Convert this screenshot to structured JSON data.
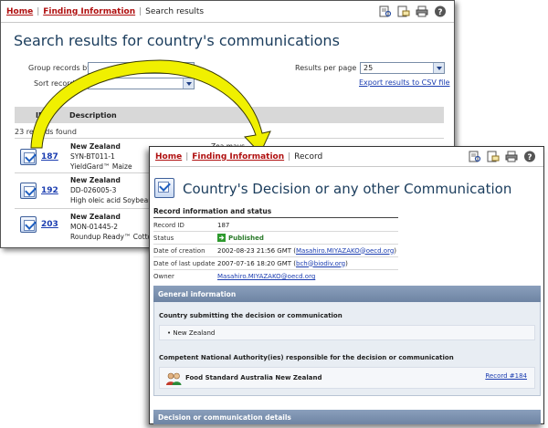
{
  "back_window": {
    "breadcrumb": {
      "home": "Home",
      "finding": "Finding Information",
      "current": "Search results"
    },
    "title": "Search results for country's communications",
    "group_by_label": "Group records by",
    "sort_by_label": "Sort records by",
    "results_per_page_label": "Results per page",
    "results_per_page_value": "25",
    "export_link": "Export results to CSV file",
    "table_headers": {
      "id": "ID",
      "description": "Description"
    },
    "records_found": "23 records found",
    "rows": [
      {
        "id": "187",
        "country": "New Zealand",
        "code": "SYN-BT011-1",
        "product": "YieldGard™ Maize",
        "extra": "Zea mays"
      },
      {
        "id": "192",
        "country": "New Zealand",
        "code": "DD-026005-3",
        "product": "High oleic acid Soybean",
        "extra": ""
      },
      {
        "id": "203",
        "country": "New Zealand",
        "code": "MON-01445-2",
        "product": "Roundup Ready™ Cotton",
        "extra": ""
      }
    ]
  },
  "front_window": {
    "breadcrumb": {
      "home": "Home",
      "finding": "Finding Information",
      "current": "Record"
    },
    "title": "Country's Decision or any other Communication",
    "section_title": "Record information and status",
    "fields": [
      {
        "key": "Record ID",
        "value": "187"
      },
      {
        "key": "Status",
        "value": "Published"
      },
      {
        "key": "Date of creation",
        "value": "2002-08-23 21:56 GMT",
        "link": "Masahiro.MIYAZAKO@oecd.org"
      },
      {
        "key": "Date of last update",
        "value": "2007-07-16 18:20 GMT",
        "link": "bch@biodiv.org"
      },
      {
        "key": "Owner",
        "value": "",
        "link": "Masahiro.MIYAZAKO@oecd.org"
      }
    ],
    "general_info_header": "General information",
    "country_label": "Country submitting the decision or communication",
    "country_value": "• New Zealand",
    "cna_label": "Competent National Authority(ies) responsible for the decision or communication",
    "cna_value": "Food Standard Australia New Zealand",
    "cna_record_link": "Record #184",
    "details_header": "Decision or communication details"
  },
  "colors": {
    "arrow_fill": "#f0f000",
    "arrow_stroke": "#3a3a00",
    "title_blue": "#1a3c5c",
    "link_blue": "#1a3cb0",
    "crumb_red": "#b01010",
    "panel_header": "#7a8fad"
  }
}
